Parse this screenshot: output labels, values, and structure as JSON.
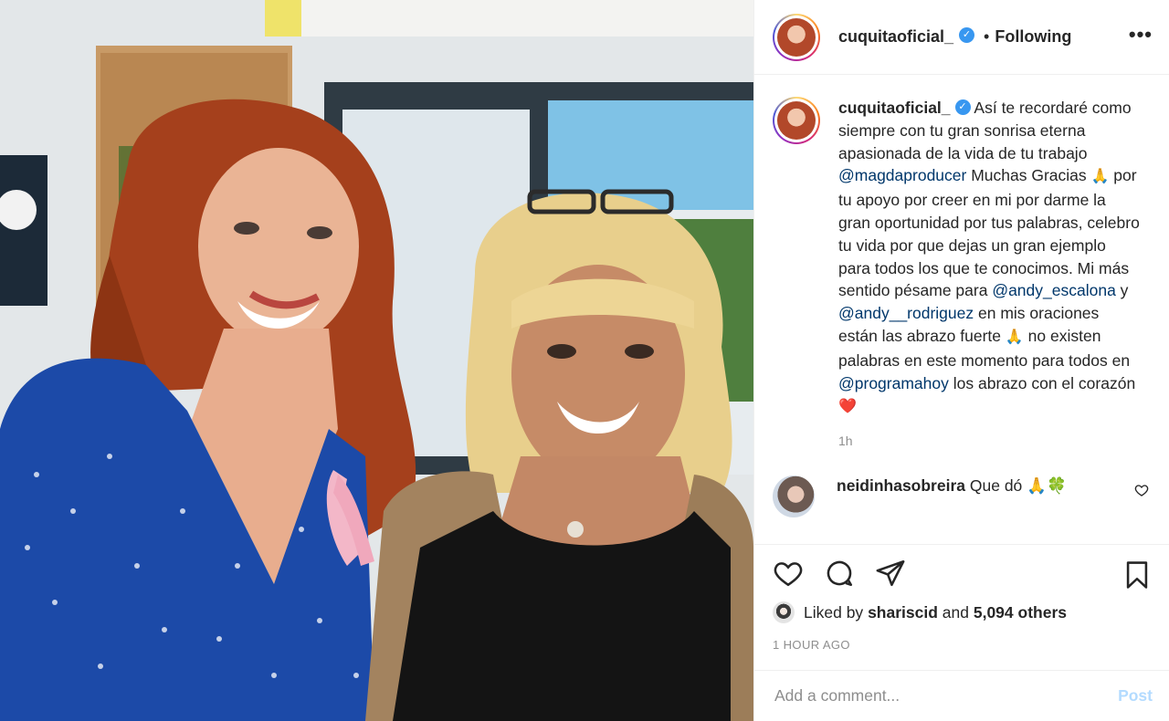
{
  "post": {
    "username": "cuquitaoficial_",
    "verified_icon": "verified-badge-icon",
    "separator": "•",
    "follow_status": "Following",
    "more_icon": "more-options-icon",
    "more_glyph": "•••"
  },
  "caption": {
    "username": "cuquitaoficial_",
    "parts": [
      " Así te recordaré como siempre con tu gran sonrisa eterna apasionada de la vida de tu trabajo ",
      "@magdaproducer",
      " Muchas Gracias ",
      "🙏",
      " por tu apoyo por creer en mi por darme la gran oportunidad por tus palabras, celebro tu vida por que dejas un gran ejemplo para todos los que te conocimos. Mi más sentido pésame para ",
      "@andy_escalona",
      " y ",
      "@andy__rodriguez",
      " en mis oraciones están las abrazo fuerte ",
      "🙏",
      " no existen palabras en este momento para todos en ",
      "@programahoy",
      " los abrazo con el corazón ",
      "❤️"
    ],
    "time": "1h"
  },
  "comment": {
    "username": "neidinhasobreira",
    "text": " Que dó ",
    "emojis": "🙏🍀"
  },
  "actions": {
    "like_icon": "heart-icon",
    "comment_icon": "comment-icon",
    "share_icon": "share-icon",
    "save_icon": "bookmark-icon"
  },
  "likes": {
    "prefix": "Liked by ",
    "user": "shariscid",
    "middle": " and ",
    "count": "5,094 others"
  },
  "timestamp": "1 HOUR AGO",
  "add_comment": {
    "placeholder": "Add a comment...",
    "post_label": "Post"
  },
  "colors": {
    "mention": "#00376b",
    "verified": "#3897f0",
    "post_disabled": "#b3dbff",
    "secondary_text": "#8e8e8e"
  }
}
